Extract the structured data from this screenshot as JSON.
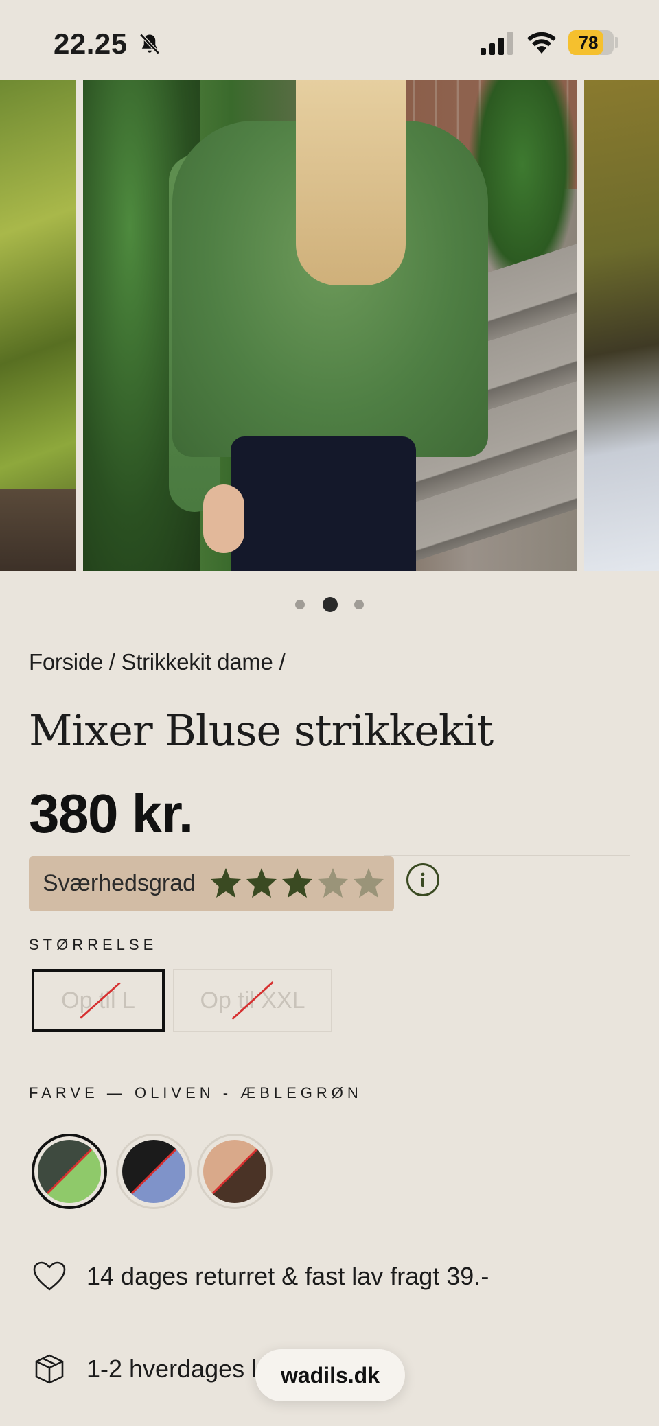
{
  "status_bar": {
    "time": "22.25",
    "battery": "78",
    "battery_percent": 78,
    "icons": [
      "bell-slash-icon",
      "signal-icon",
      "wifi-icon",
      "battery-icon"
    ]
  },
  "gallery": {
    "image_count": 3,
    "active_index": 1,
    "zoom_icon": "magnifier-icon"
  },
  "product": {
    "breadcrumb": "Forside / Strikkekit dame /",
    "title": "Mixer Bluse strikkekit",
    "price": "380 kr.",
    "difficulty": {
      "label": "Sværhedsgrad",
      "rating": 3,
      "max": 5,
      "info_icon": "info-icon"
    },
    "size": {
      "label": "STØRRELSE",
      "options": [
        {
          "label": "Op til L",
          "selected": true,
          "available": false
        },
        {
          "label": "Op til XXL",
          "selected": false,
          "available": false
        }
      ]
    },
    "color": {
      "label": "FARVE — OLIVEN - ÆBLEGRØN",
      "swatches": [
        {
          "name": "oliven-aeblegroen",
          "c1": "#3e4a3f",
          "c2": "#8fc96a",
          "selected": true
        },
        {
          "name": "black-blue",
          "c1": "#1b1b1b",
          "c2": "#7f93c9",
          "selected": false
        },
        {
          "name": "peach-brown",
          "c1": "#d9a98a",
          "c2": "#4a3326",
          "selected": false
        }
      ]
    },
    "perks": [
      {
        "icon": "heart-icon",
        "text": "14 dages returret & fast lav fragt 39.-"
      },
      {
        "icon": "box-icon",
        "text": "1-2 hverdages le"
      }
    ]
  },
  "browser": {
    "url": "wadils.dk"
  },
  "colors": {
    "background": "#e9e4dc",
    "difficulty_bg": "#d2bca5",
    "star_filled": "#3a4a22",
    "star_empty": "#9a9479",
    "battery": "#f5c02e"
  }
}
